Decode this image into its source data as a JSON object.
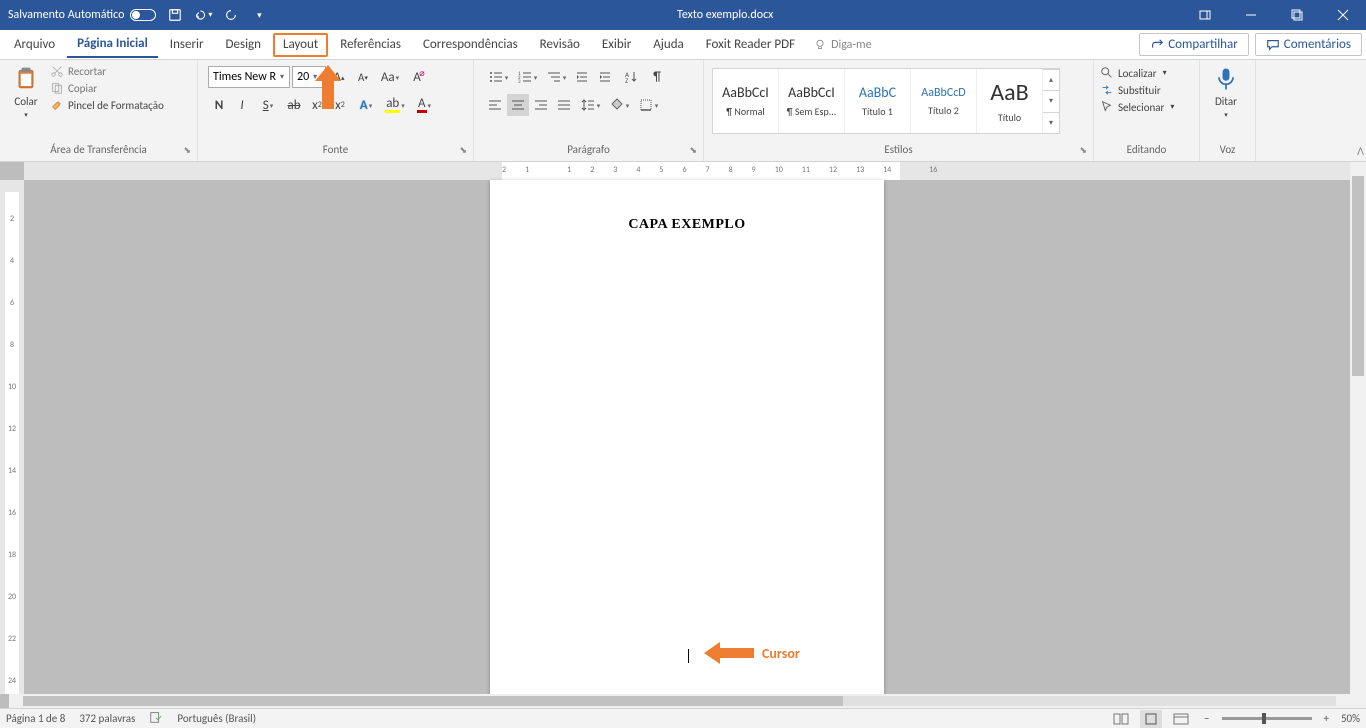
{
  "titlebar": {
    "autosave": "Salvamento Automático",
    "filename": "Texto exemplo.docx"
  },
  "tabs": {
    "file": "Arquivo",
    "home": "Página Inicial",
    "insert": "Inserir",
    "design": "Design",
    "layout": "Layout",
    "references": "Referências",
    "mailings": "Correspondências",
    "review": "Revisão",
    "view": "Exibir",
    "help": "Ajuda",
    "foxit": "Foxit Reader PDF",
    "tellme": "Diga-me",
    "share": "Compartilhar",
    "comments": "Comentários"
  },
  "clipboard": {
    "paste": "Colar",
    "cut": "Recortar",
    "copy": "Copiar",
    "painter": "Pincel de Formatação",
    "group": "Área de Transferência"
  },
  "font": {
    "name": "Times New R",
    "size": "20",
    "group": "Fonte"
  },
  "para": {
    "group": "Parágrafo"
  },
  "styles": {
    "group": "Estilos",
    "items": [
      {
        "preview": "AaBbCcI",
        "name": "¶ Normal",
        "cls": ""
      },
      {
        "preview": "AaBbCcI",
        "name": "¶ Sem Esp...",
        "cls": ""
      },
      {
        "preview": "AaBbC",
        "name": "Título 1",
        "cls": "heading"
      },
      {
        "preview": "AaBbCcD",
        "name": "Título 2",
        "cls": "heading"
      },
      {
        "preview": "AaB",
        "name": "Título",
        "cls": "title"
      }
    ]
  },
  "editing": {
    "find": "Localizar",
    "replace": "Substituir",
    "select": "Selecionar",
    "group": "Editando"
  },
  "voice": {
    "dictate": "Ditar",
    "group": "Voz"
  },
  "document": {
    "title": "CAPA EXEMPLO"
  },
  "annotation": {
    "cursor": "Cursor"
  },
  "ruler": {
    "h": [
      "2",
      "1",
      "",
      "1",
      "2",
      "3",
      "4",
      "5",
      "6",
      "7",
      "8",
      "9",
      "10",
      "11",
      "12",
      "13",
      "14",
      "",
      "16"
    ],
    "v": [
      "",
      "2",
      "",
      "4",
      "",
      "6",
      "",
      "8",
      "",
      "10",
      "",
      "12",
      "",
      "14",
      "",
      "16",
      "",
      "18",
      "",
      "20",
      "",
      "22",
      "",
      "24"
    ]
  },
  "status": {
    "page": "Página 1 de 8",
    "words": "372 palavras",
    "lang": "Português (Brasil)",
    "zoom": "50%"
  }
}
